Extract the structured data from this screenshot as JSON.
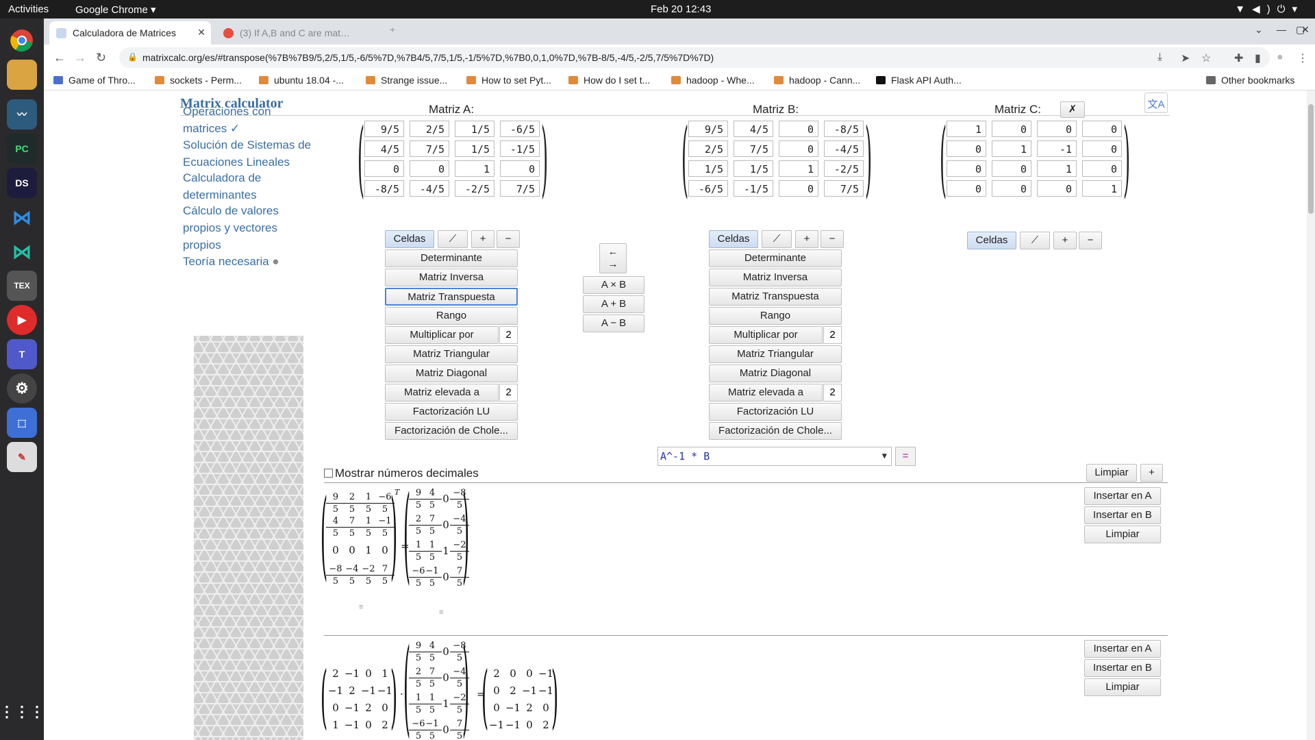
{
  "topbar": {
    "activities": "Activities",
    "app": "Google Chrome ▾",
    "clock": "Feb 20  12:43",
    "tray": "▼◀)⏻▾"
  },
  "dock": {
    "items": [
      "chrome-icon",
      "files-icon",
      "mysql-workbench-icon",
      "pycharm-icon",
      "dataspell-icon",
      "vscode-icon",
      "vscode-insiders-icon",
      "texmaker-icon",
      "media-player-icon",
      "teams-icon",
      "settings-icon",
      "screenshot-icon",
      "text-editor-icon",
      "apps-grid-icon"
    ],
    "labels": {
      "pycharm": "PC",
      "dataspell": "DS",
      "texmaker": "TEX",
      "apps": "⋮⋮⋮"
    }
  },
  "browser": {
    "tabs": [
      {
        "title": "Calculadora de Matrices",
        "active": true
      },
      {
        "title": "(3) If A,B and C are mat…",
        "active": false
      }
    ],
    "new_tab": "+",
    "url": "matrixcalc.org/es/#transpose(%7B%7B9/5,2/5,1/5,-6/5%7D,%7B4/5,7/5,1/5,-1/5%7D,%7B0,0,1,0%7D,%7B-8/5,-4/5,-2/5,7/5%7D%7D)",
    "bookmarks": [
      "Game of Thro...",
      "sockets - Perm...",
      "ubuntu 18.04 -...",
      "Strange issue...",
      "How to set Pyt...",
      "How do I set t...",
      "hadoop - Whe...",
      "hadoop - Cann...",
      "Flask API Auth..."
    ],
    "other_bookmarks": "Other bookmarks"
  },
  "site": {
    "title": "Matrix calculator",
    "translate_icon": "文A"
  },
  "sidebar": {
    "links": [
      [
        "Operaciones con",
        "matrices ✓"
      ],
      [
        "Solución de Sistemas de",
        "Ecuaciones Lineales"
      ],
      [
        "Calculadora de",
        "determinantes"
      ],
      [
        "Cálculo de valores",
        "propios y vectores",
        "propios"
      ],
      [
        "Teoría necesaria"
      ]
    ]
  },
  "matrixA": {
    "label": "Matriz A:",
    "cells": [
      [
        "9/5",
        "2/5",
        "1/5",
        "-6/5"
      ],
      [
        "4/5",
        "7/5",
        "1/5",
        "-1/5"
      ],
      [
        "0",
        "0",
        "1",
        "0"
      ],
      [
        "-8/5",
        "-4/5",
        "-2/5",
        "7/5"
      ]
    ]
  },
  "matrixB": {
    "label": "Matriz B:",
    "cells": [
      [
        "9/5",
        "4/5",
        "0",
        "-8/5"
      ],
      [
        "2/5",
        "7/5",
        "0",
        "-4/5"
      ],
      [
        "1/5",
        "1/5",
        "1",
        "-2/5"
      ],
      [
        "-6/5",
        "-1/5",
        "0",
        "7/5"
      ]
    ]
  },
  "matrixC": {
    "label": "Matriz C:",
    "close": "✗",
    "cells": [
      [
        "1",
        "0",
        "0",
        "0"
      ],
      [
        "0",
        "1",
        "-1",
        "0"
      ],
      [
        "0",
        "0",
        "1",
        "0"
      ],
      [
        "0",
        "0",
        "0",
        "1"
      ]
    ]
  },
  "controls": {
    "cells": "Celdas",
    "pen": "✓",
    "plus": "+",
    "minus": "−"
  },
  "ops": [
    "Determinante",
    "Matriz Inversa",
    "Matriz Transpuesta",
    "Rango",
    "Multiplicar por",
    "Matriz Triangular",
    "Matriz Diagonal",
    "Matriz elevada a",
    "Factorización LU",
    "Factorización de Chole..."
  ],
  "op_values": {
    "multiply": "2",
    "power": "2"
  },
  "middle": {
    "swap_top": "←",
    "swap_bottom": "→",
    "mult": "A × B",
    "add": "A + B",
    "sub": "A − B"
  },
  "formula": {
    "value": "A^-1 * B",
    "dropdown": "▼",
    "equals": "="
  },
  "options": {
    "decimals_label": "Mostrar números decimales",
    "clear": "Limpiar",
    "add": "+"
  },
  "result_actions": {
    "insert_a": "Insertar en A",
    "insert_b": "Insertar en B",
    "clear": "Limpiar"
  },
  "result1": {
    "lhs": [
      [
        "9/5",
        "2/5",
        "1/5",
        "-6/5"
      ],
      [
        "4/5",
        "7/5",
        "1/5",
        "-1/5"
      ],
      [
        "0",
        "0",
        "1",
        "0"
      ],
      [
        "-8/5",
        "-4/5",
        "-2/5",
        "7/5"
      ]
    ],
    "sup": "T",
    "eq": "=",
    "rhs": [
      [
        "9/5",
        "4/5",
        "0",
        "-8/5"
      ],
      [
        "2/5",
        "7/5",
        "0",
        "-4/5"
      ],
      [
        "1/5",
        "1/5",
        "1",
        "-2/5"
      ],
      [
        "-6/5",
        "-1/5",
        "0",
        "7/5"
      ]
    ]
  },
  "result2": {
    "m1": [
      [
        "2",
        "-1",
        "0",
        "1"
      ],
      [
        "-1",
        "2",
        "-1",
        "-1"
      ],
      [
        "0",
        "-1",
        "2",
        "0"
      ],
      [
        "1",
        "-1",
        "0",
        "2"
      ]
    ],
    "dot": "·",
    "m2": [
      [
        "9/5",
        "4/5",
        "0",
        "-8/5"
      ],
      [
        "2/5",
        "7/5",
        "0",
        "-4/5"
      ],
      [
        "1/5",
        "1/5",
        "1",
        "-2/5"
      ],
      [
        "-6/5",
        "-1/5",
        "0",
        "7/5"
      ]
    ],
    "eq": "=",
    "m3": [
      [
        "2",
        "0",
        "0",
        "-1"
      ],
      [
        "0",
        "2",
        "-1",
        "-1"
      ],
      [
        "0",
        "-1",
        "2",
        "0"
      ],
      [
        "-1",
        "-1",
        "0",
        "2"
      ]
    ]
  }
}
